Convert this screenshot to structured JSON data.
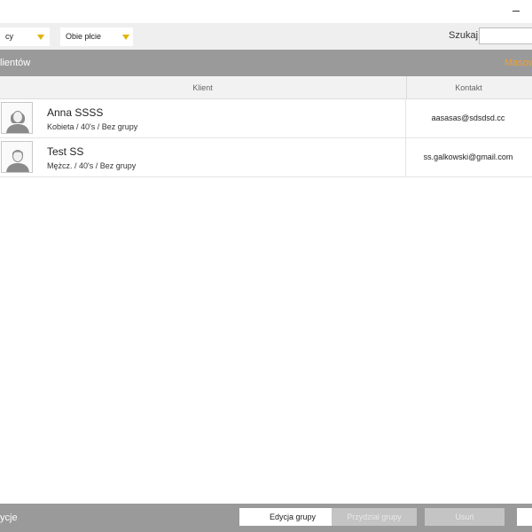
{
  "window": {},
  "filters": {
    "select1": {
      "value": "cy"
    },
    "select2": {
      "value": "Obie płcie"
    },
    "search": {
      "label": "Szukaj",
      "value": ""
    }
  },
  "section": {
    "title": "lientów",
    "link": "Masow"
  },
  "table": {
    "columns": [
      "Klient",
      "Kontakt"
    ],
    "rows": [
      {
        "name": "Anna SSSS",
        "meta": "Kobieta / 40's / Bez grupy",
        "email": "aasasas@sdsdsd.cc",
        "gender": "female"
      },
      {
        "name": "Test SS",
        "meta": "Mężcz. / 40's / Bez grupy",
        "email": "ss.galkowski@gmail.com",
        "gender": "male"
      }
    ]
  },
  "footer": {
    "label": "ycje",
    "buttons": {
      "edit": "Edycja grupy",
      "assign": "Przydział grupy",
      "delete": "Usuń",
      "more": ""
    }
  },
  "colors": {
    "accent": "#f0a030",
    "dropdown_arrow": "#e0b400",
    "bar_gray": "#9a9a9a"
  },
  "icons": {
    "dropdown": "chevron-down-icon",
    "avatar_female": "user-female-icon",
    "avatar_male": "user-male-icon"
  }
}
